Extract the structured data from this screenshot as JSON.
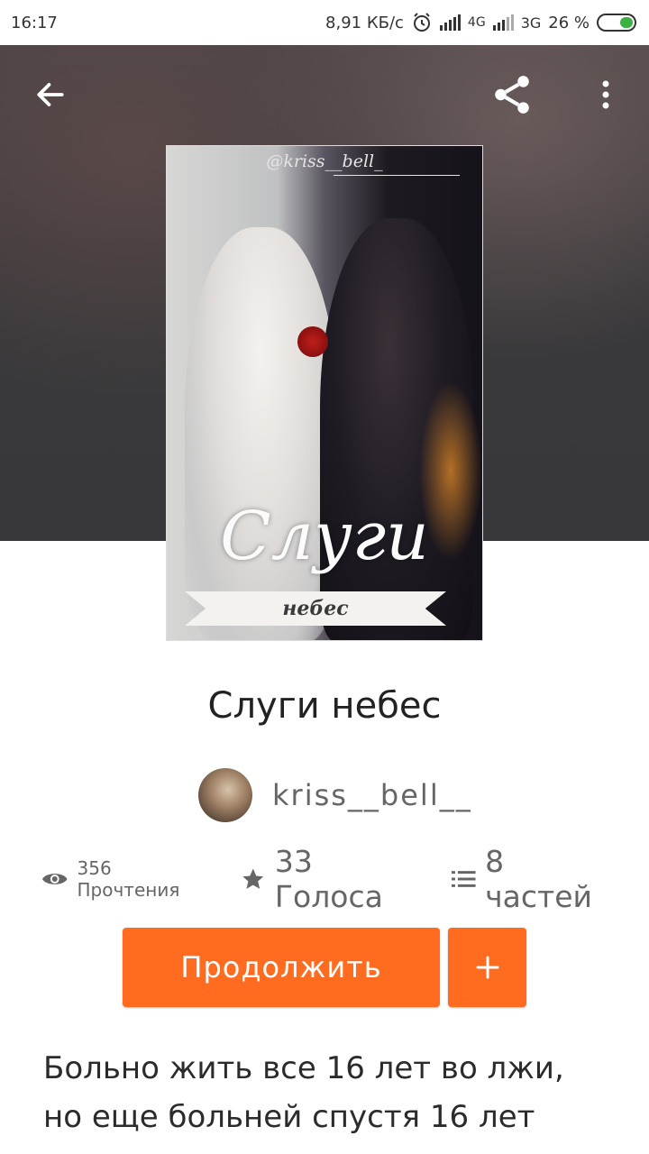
{
  "status_bar": {
    "time": "16:17",
    "speed": "8,91 КБ/с",
    "net1": "4G",
    "net2": "3G",
    "battery": "26 %"
  },
  "header": {
    "back_icon": "arrow-left-icon",
    "share_icon": "share-icon",
    "menu_icon": "more-vert-icon"
  },
  "cover": {
    "handle": "@kriss__bell_",
    "title": "Слуги",
    "subtitle": "небес"
  },
  "story": {
    "title": "Слуги небес",
    "author": "kriss__bell__"
  },
  "stats": {
    "reads": "356 Прочтения",
    "votes": "33 Голоса",
    "parts": "8 частей"
  },
  "actions": {
    "continue_label": "Продолжить",
    "add_label": "+"
  },
  "description": {
    "line1": "Больно жить все 16 лет во лжи,",
    "line2": "но еще больней спустя 16 лет"
  },
  "colors": {
    "accent": "#ff6c1f",
    "hero_bg": "#3a393b"
  }
}
